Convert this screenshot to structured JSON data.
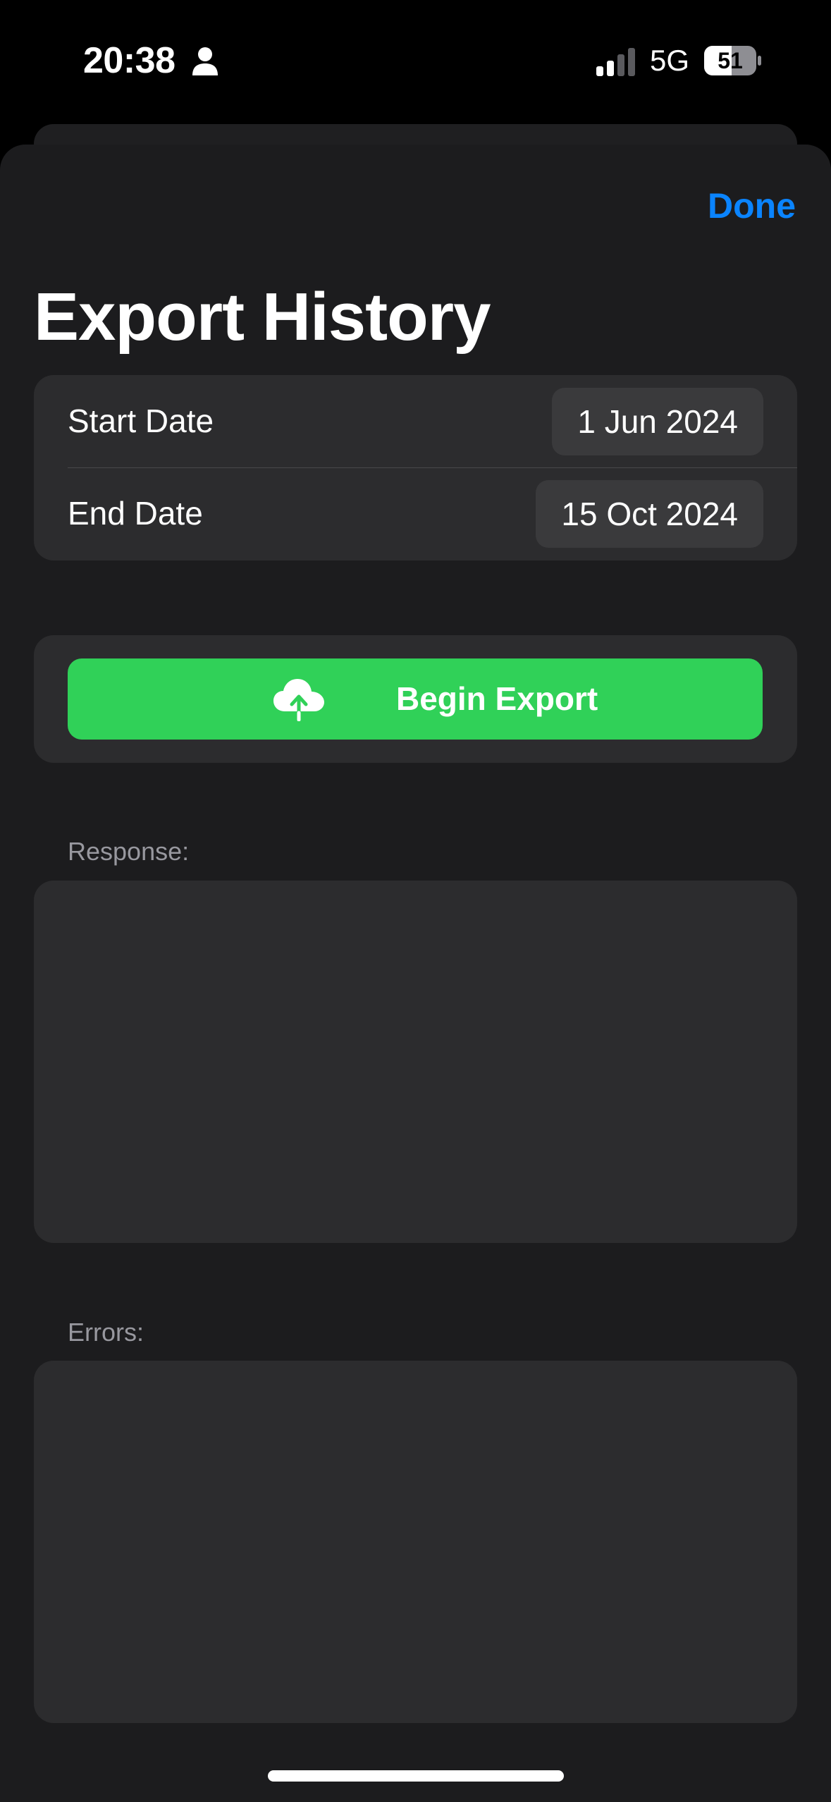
{
  "status_bar": {
    "time": "20:38",
    "network": "5G",
    "battery": "51"
  },
  "nav": {
    "done_label": "Done"
  },
  "title": "Export History",
  "dates": {
    "start_label": "Start Date",
    "start_value": "1 Jun 2024",
    "end_label": "End Date",
    "end_value": "15 Oct 2024"
  },
  "export": {
    "button_label": "Begin Export",
    "icon": "cloud-upload-icon"
  },
  "response": {
    "caption": "Response:",
    "value": ""
  },
  "errors": {
    "caption": "Errors:",
    "value": ""
  },
  "colors": {
    "accent": "#0a84ff",
    "export_button": "#30d158",
    "background": "#1c1c1e",
    "group_background": "#2c2c2e"
  }
}
